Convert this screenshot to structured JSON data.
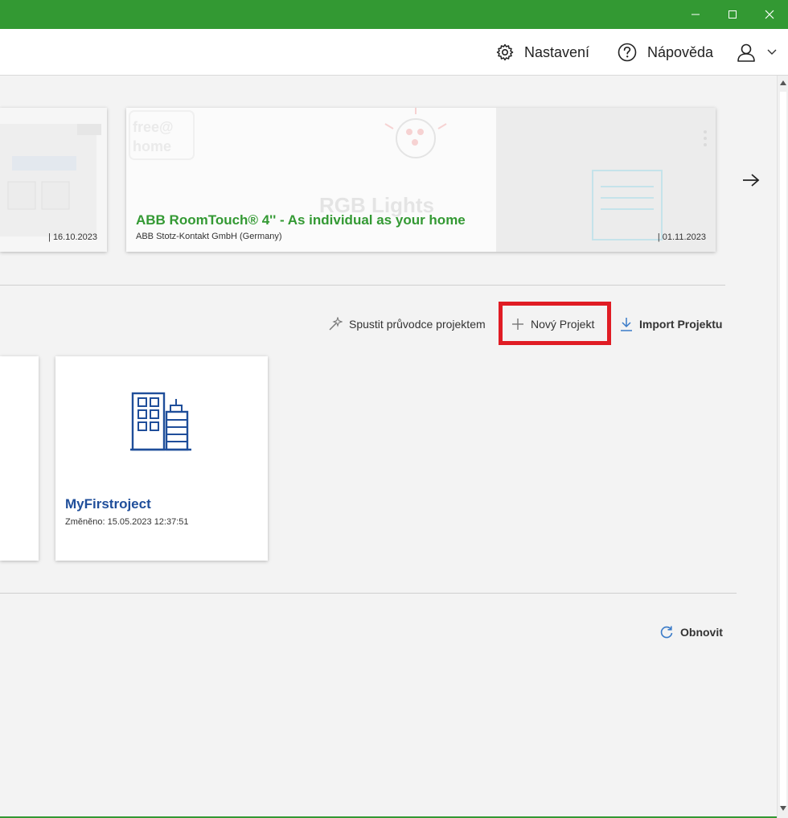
{
  "header": {
    "settings_label": "Nastavení",
    "help_label": "Nápověda"
  },
  "news": [
    {
      "title": "",
      "publisher": "",
      "date": "16.10.2023"
    },
    {
      "title": "ABB RoomTouch® 4'' - As individual as your home",
      "publisher": "ABB Stotz-Kontakt GmbH (Germany)",
      "date": "01.11.2023",
      "image_text": "RGB Lights"
    }
  ],
  "logo": {
    "line1": "free@",
    "line2": "home"
  },
  "actions": {
    "wizard_label": "Spustit průvodce projektem",
    "new_project_label": "Nový Projekt",
    "import_label": "Import Projektu"
  },
  "projects": [
    {
      "name": "MyFirstroject",
      "modified": "Změněno: 15.05.2023 12:37:51"
    }
  ],
  "refresh_label": "Obnovit",
  "colors": {
    "brand_green": "#339933",
    "project_blue": "#1f4e9a",
    "highlight_red": "#e01c24"
  }
}
